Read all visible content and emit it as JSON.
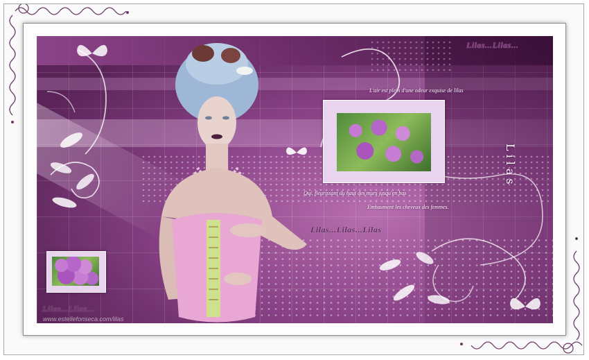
{
  "artwork": {
    "poem_line_1": "L'air est plein d'une odeur exquise de lilas",
    "poem_line_2": "Qui, fleurissant du haut des murs jusqu'en bas",
    "poem_line_3": "Embaument les cheveux des femmes.",
    "vertical_title": "Lilas",
    "banner_top_right": "Lilas...Lilas...",
    "banner_middle": "Lilas...Lilas...Lilas",
    "banner_bottom_left": "Lilas...Lilas...",
    "watermark": "www.estellefonseca.com/lilas"
  },
  "colors": {
    "background_purple": "#8c4489",
    "frame_white": "#ffffff"
  }
}
